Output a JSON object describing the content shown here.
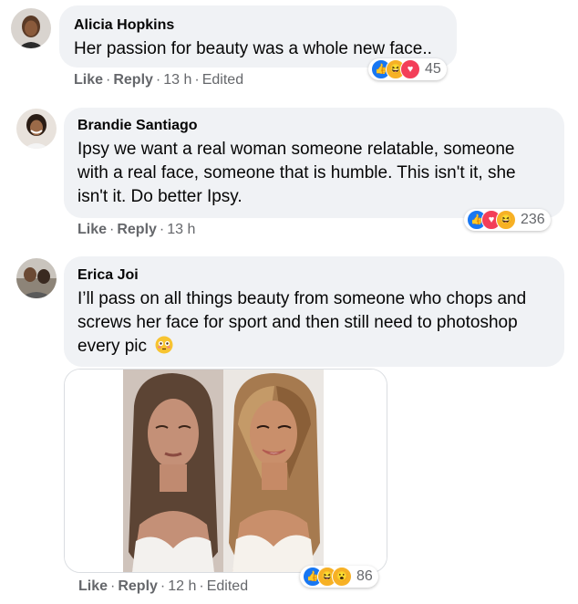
{
  "comments": [
    {
      "author": "Alicia Hopkins",
      "text": "Her passion for beauty was a whole new face..",
      "actions": {
        "like": "Like",
        "reply": "Reply",
        "time": "13 h",
        "edited": "Edited"
      },
      "reactions": {
        "count": "45",
        "types": [
          "like",
          "haha",
          "love"
        ]
      }
    },
    {
      "author": "Brandie Santiago",
      "text_lines": [
        "Ipsy we want a real woman someone relatable, someone",
        "with a real face, someone that is humble. This isn't it, she",
        "isn't it. Do better Ipsy."
      ],
      "actions": {
        "like": "Like",
        "reply": "Reply",
        "time": "13 h"
      },
      "reactions": {
        "count": "236",
        "types": [
          "like",
          "love",
          "haha"
        ]
      }
    },
    {
      "author": "Erica Joi",
      "text_lines": [
        "I’ll pass on all things beauty from someone who chops and",
        "screws her face for sport and then still need to photoshop",
        "every pic"
      ],
      "emoji": "flushed-face",
      "actions": {
        "like": "Like",
        "reply": "Reply",
        "time": "12 h",
        "edited": "Edited"
      },
      "reactions": {
        "count": "86",
        "types": [
          "like",
          "haha",
          "wow"
        ]
      },
      "photo": {
        "description_hidden": true
      }
    }
  ],
  "colors": {
    "bubble": "#f0f2f5",
    "secondary_text": "#65676b",
    "like_blue": "#1877f2",
    "love_red": "#f33e58",
    "haha_yellow": "#f7b125"
  }
}
